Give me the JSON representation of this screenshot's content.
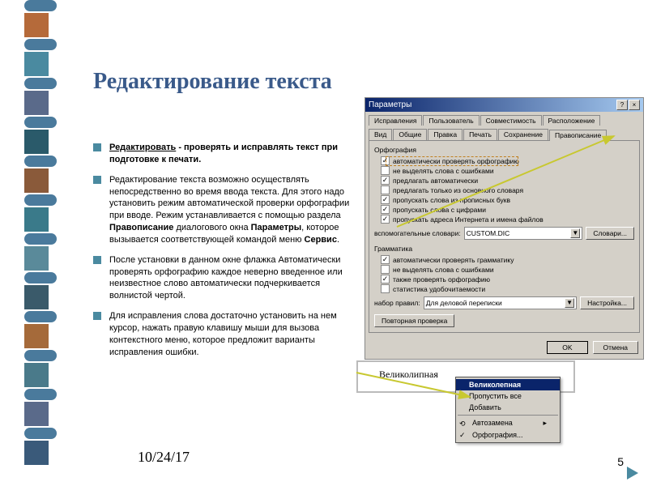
{
  "title": "Редактирование текста",
  "bullets": [
    {
      "bold_uline": "Редактировать",
      "rest_bold": " - проверять и исправлять текст при подготовке к печати."
    },
    {
      "text": "Редактирование текста возможно осуществлять непосредственно во время ввода текста. Для этого надо установить режим автоматической проверки орфографии при вводе. Режим устанавливается с помощью раздела ",
      "b1": "Правописание",
      "mid": " диалогового окна ",
      "b2": "Параметры",
      "mid2": ", которое вызывается соответствующей командой меню ",
      "b3": "Сервис",
      "end": "."
    },
    {
      "text": "После установки в данном окне флажка Автоматически проверять орфографию каждое неверно введенное или неизвестное слово автоматически подчеркивается волнистой чертой."
    },
    {
      "text": "Для исправления слова достаточно установить на нем курсор, нажать правую клавишу мыши для вызова контекстного меню, которое предложит варианты исправления ошибки."
    }
  ],
  "footer": {
    "date": "10/24/17",
    "page": "5"
  },
  "dialog": {
    "title": "Параметры",
    "tabs_row1": [
      "Исправления",
      "Пользователь",
      "Совместимость",
      "Расположение"
    ],
    "tabs_row2": [
      "Вид",
      "Общие",
      "Правка",
      "Печать",
      "Сохранение",
      "Правописание"
    ],
    "group1": "Орфография",
    "checks1": [
      {
        "on": true,
        "label": "автоматически проверять орфографию"
      },
      {
        "on": false,
        "label": "не выделять слова с ошибками"
      },
      {
        "on": true,
        "label": "предлагать автоматически"
      },
      {
        "on": false,
        "label": "предлагать только из основного словаря"
      },
      {
        "on": true,
        "label": "пропускать слова из прописных букв"
      },
      {
        "on": true,
        "label": "пропускать слова с цифрами"
      },
      {
        "on": true,
        "label": "пропускать адреса Интернета и имена файлов"
      }
    ],
    "dict_label": "вспомогательные словари:",
    "dict_value": "CUSTOM.DIC",
    "dict_btn": "Словари...",
    "group2": "Грамматика",
    "checks2": [
      {
        "on": true,
        "label": "автоматически проверять грамматику"
      },
      {
        "on": false,
        "label": "не выделять слова с ошибками"
      },
      {
        "on": true,
        "label": "также проверять орфографию"
      },
      {
        "on": false,
        "label": "статистика удобочитаемости"
      }
    ],
    "rules_label": "набор правил:",
    "rules_value": "Для деловой переписки",
    "rules_btn": "Настройка...",
    "recheck_btn": "Повторная проверка",
    "ok": "OK",
    "cancel": "Отмена"
  },
  "context": {
    "wrong_word": "Великолипная",
    "items": [
      "Великолепная",
      "Пропустить все",
      "Добавить",
      "Автозамена",
      "Орфография..."
    ],
    "highlight_index": 0
  },
  "deco_colors": [
    "#b56a3a",
    "#4a8aa0",
    "#5a6a8a",
    "#2a5a6a",
    "#8a5a3a",
    "#3a7a8a",
    "#5a8a9a",
    "#3a5a6a",
    "#a56a3a",
    "#4a7a8a",
    "#5a6a8a",
    "#3a5a7a",
    "#8a6a3a",
    "#4a8a9a",
    "#5a7a8a"
  ]
}
